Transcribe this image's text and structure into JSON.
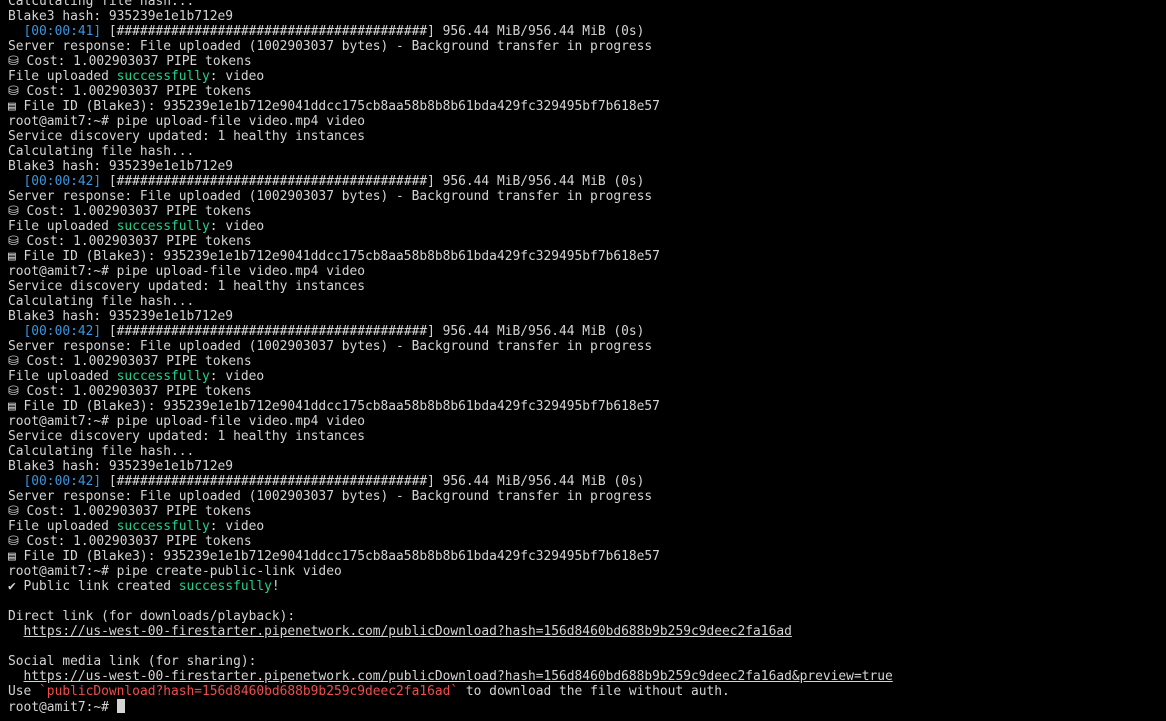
{
  "terminal": {
    "lines": [
      {
        "t": "text",
        "v": "Calculating file hash..."
      },
      {
        "t": "text",
        "v": "Blake3 hash: 935239e1e1b712e9"
      },
      {
        "t": "progress",
        "time": "  [00:00:41]",
        "rest": " [########################################] 956.44 MiB/956.44 MiB (0s)"
      },
      {
        "t": "text",
        "v": "Server response: File uploaded (1002903037 bytes) - Background transfer in progress"
      },
      {
        "t": "text",
        "v": "⛁ Cost: 1.002903037 PIPE tokens"
      },
      {
        "t": "success",
        "a": "File uploaded ",
        "s": "successfully",
        "b": ": video"
      },
      {
        "t": "text",
        "v": "⛁ Cost: 1.002903037 PIPE tokens"
      },
      {
        "t": "text",
        "v": "▤ File ID (Blake3): 935239e1e1b712e9041ddcc175cb8aa58b8b8b61bda429fc329495bf7b618e57"
      },
      {
        "t": "text",
        "v": "root@amit7:~# pipe upload-file video.mp4 video"
      },
      {
        "t": "text",
        "v": "Service discovery updated: 1 healthy instances"
      },
      {
        "t": "text",
        "v": "Calculating file hash..."
      },
      {
        "t": "text",
        "v": "Blake3 hash: 935239e1e1b712e9"
      },
      {
        "t": "progress",
        "time": "  [00:00:42]",
        "rest": " [########################################] 956.44 MiB/956.44 MiB (0s)"
      },
      {
        "t": "text",
        "v": "Server response: File uploaded (1002903037 bytes) - Background transfer in progress"
      },
      {
        "t": "text",
        "v": "⛁ Cost: 1.002903037 PIPE tokens"
      },
      {
        "t": "success",
        "a": "File uploaded ",
        "s": "successfully",
        "b": ": video"
      },
      {
        "t": "text",
        "v": "⛁ Cost: 1.002903037 PIPE tokens"
      },
      {
        "t": "text",
        "v": "▤ File ID (Blake3): 935239e1e1b712e9041ddcc175cb8aa58b8b8b61bda429fc329495bf7b618e57"
      },
      {
        "t": "text",
        "v": "root@amit7:~# pipe upload-file video.mp4 video"
      },
      {
        "t": "text",
        "v": "Service discovery updated: 1 healthy instances"
      },
      {
        "t": "text",
        "v": "Calculating file hash..."
      },
      {
        "t": "text",
        "v": "Blake3 hash: 935239e1e1b712e9"
      },
      {
        "t": "progress",
        "time": "  [00:00:42]",
        "rest": " [########################################] 956.44 MiB/956.44 MiB (0s)"
      },
      {
        "t": "text",
        "v": "Server response: File uploaded (1002903037 bytes) - Background transfer in progress"
      },
      {
        "t": "text",
        "v": "⛁ Cost: 1.002903037 PIPE tokens"
      },
      {
        "t": "success",
        "a": "File uploaded ",
        "s": "successfully",
        "b": ": video"
      },
      {
        "t": "text",
        "v": "⛁ Cost: 1.002903037 PIPE tokens"
      },
      {
        "t": "text",
        "v": "▤ File ID (Blake3): 935239e1e1b712e9041ddcc175cb8aa58b8b8b61bda429fc329495bf7b618e57"
      },
      {
        "t": "text",
        "v": "root@amit7:~# pipe upload-file video.mp4 video"
      },
      {
        "t": "text",
        "v": "Service discovery updated: 1 healthy instances"
      },
      {
        "t": "text",
        "v": "Calculating file hash..."
      },
      {
        "t": "text",
        "v": "Blake3 hash: 935239e1e1b712e9"
      },
      {
        "t": "progress",
        "time": "  [00:00:42]",
        "rest": " [########################################] 956.44 MiB/956.44 MiB (0s)"
      },
      {
        "t": "text",
        "v": "Server response: File uploaded (1002903037 bytes) - Background transfer in progress"
      },
      {
        "t": "text",
        "v": "⛁ Cost: 1.002903037 PIPE tokens"
      },
      {
        "t": "success",
        "a": "File uploaded ",
        "s": "successfully",
        "b": ": video"
      },
      {
        "t": "text",
        "v": "⛁ Cost: 1.002903037 PIPE tokens"
      },
      {
        "t": "text",
        "v": "▤ File ID (Blake3): 935239e1e1b712e9041ddcc175cb8aa58b8b8b61bda429fc329495bf7b618e57"
      },
      {
        "t": "text",
        "v": "root@amit7:~# pipe create-public-link video"
      },
      {
        "t": "success",
        "a": "✔ Public link created ",
        "s": "successfully",
        "b": "!"
      },
      {
        "t": "text",
        "v": ""
      },
      {
        "t": "text",
        "v": "Direct link (for downloads/playback):"
      },
      {
        "t": "link",
        "pre": "  ",
        "v": "https://us-west-00-firestarter.pipenetwork.com/publicDownload?hash=156d8460bd688b9b259c9deec2fa16ad"
      },
      {
        "t": "text",
        "v": ""
      },
      {
        "t": "text",
        "v": "Social media link (for sharing):"
      },
      {
        "t": "link",
        "pre": "  ",
        "v": "https://us-west-00-firestarter.pipenetwork.com/publicDownload?hash=156d8460bd688b9b259c9deec2fa16ad&preview=true"
      },
      {
        "t": "code",
        "a": "Use ",
        "c": "`publicDownload?hash=156d8460bd688b9b259c9deec2fa16ad`",
        "b": " to download the file without auth."
      },
      {
        "t": "prompt",
        "v": "root@amit7:~# "
      }
    ]
  }
}
